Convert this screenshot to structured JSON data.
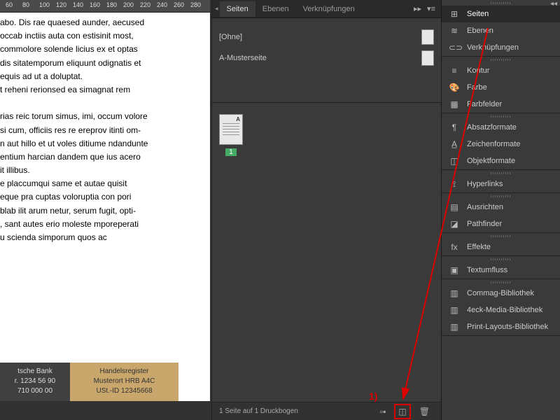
{
  "ruler": {
    "ticks": [
      "60",
      "80",
      "100",
      "120",
      "140",
      "160",
      "180",
      "200",
      "220",
      "240",
      "260",
      "280"
    ]
  },
  "document_text": [
    "abo. Dis rae quaesed aunder, aecused",
    "occab inctiis auta con estisinit most,",
    "commolore solende licius ex et optas",
    "dis sitatemporum eliquunt odignatis et",
    "equis ad ut a doluptat.",
    "t reheni rerionsed ea simagnat rem",
    "",
    "rias reic torum simus, imi, occum volore",
    "si cum, officiis res re ereprov itinti om-",
    "n aut hillo et ut voles ditiume ndandunte",
    "entium harcian dandem que ius acero",
    "it illibus.",
    "e placcumqui same et autae quisit",
    "eque pra cuptas voloruptia con pori",
    "blab ilit arum netur, serum fugit, opti-",
    ", sant autes erio moleste mporeperati",
    "u scienda simporum quos ac"
  ],
  "footer_bank": {
    "name": "tsche Bank",
    "nr": "r. 1234 56 90",
    "tel": "710 000 00"
  },
  "footer_reg": {
    "title": "Handelsregister",
    "line1": "Musterort HRB A4C",
    "line2": "USt.-ID 12345668"
  },
  "pages_panel": {
    "tabs": [
      "Seiten",
      "Ebenen",
      "Verknüpfungen"
    ],
    "masters": {
      "none": "[Ohne]",
      "a": "A-Musterseite"
    },
    "page_label": "A",
    "page_number": "1",
    "status": "1 Seite auf 1 Druckbogen"
  },
  "right_panel": {
    "groups": [
      {
        "items": [
          {
            "icon": "⊞",
            "label": "Seiten",
            "active": true
          },
          {
            "icon": "≋",
            "label": "Ebenen"
          },
          {
            "icon": "⊂⊃",
            "label": "Verknüpfungen"
          }
        ]
      },
      {
        "items": [
          {
            "icon": "≡",
            "label": "Kontur"
          },
          {
            "icon": "🎨",
            "label": "Farbe"
          },
          {
            "icon": "▦",
            "label": "Farbfelder"
          }
        ]
      },
      {
        "items": [
          {
            "icon": "¶",
            "label": "Absatzformate"
          },
          {
            "icon": "A̲",
            "label": "Zeichenformate"
          },
          {
            "icon": "◫",
            "label": "Objektformate"
          }
        ]
      },
      {
        "items": [
          {
            "icon": "⟟",
            "label": "Hyperlinks"
          }
        ]
      },
      {
        "items": [
          {
            "icon": "▤",
            "label": "Ausrichten"
          },
          {
            "icon": "◪",
            "label": "Pathfinder"
          }
        ]
      },
      {
        "items": [
          {
            "icon": "fx",
            "label": "Effekte"
          }
        ]
      },
      {
        "items": [
          {
            "icon": "▣",
            "label": "Textumfluss"
          }
        ]
      },
      {
        "items": [
          {
            "icon": "▥",
            "label": "Commag-Bibliothek"
          },
          {
            "icon": "▥",
            "label": "4eck-Media-Bibliothek"
          },
          {
            "icon": "▥",
            "label": "Print-Layouts-Bibliothek"
          }
        ]
      }
    ]
  },
  "annotation": {
    "label": "1)"
  }
}
